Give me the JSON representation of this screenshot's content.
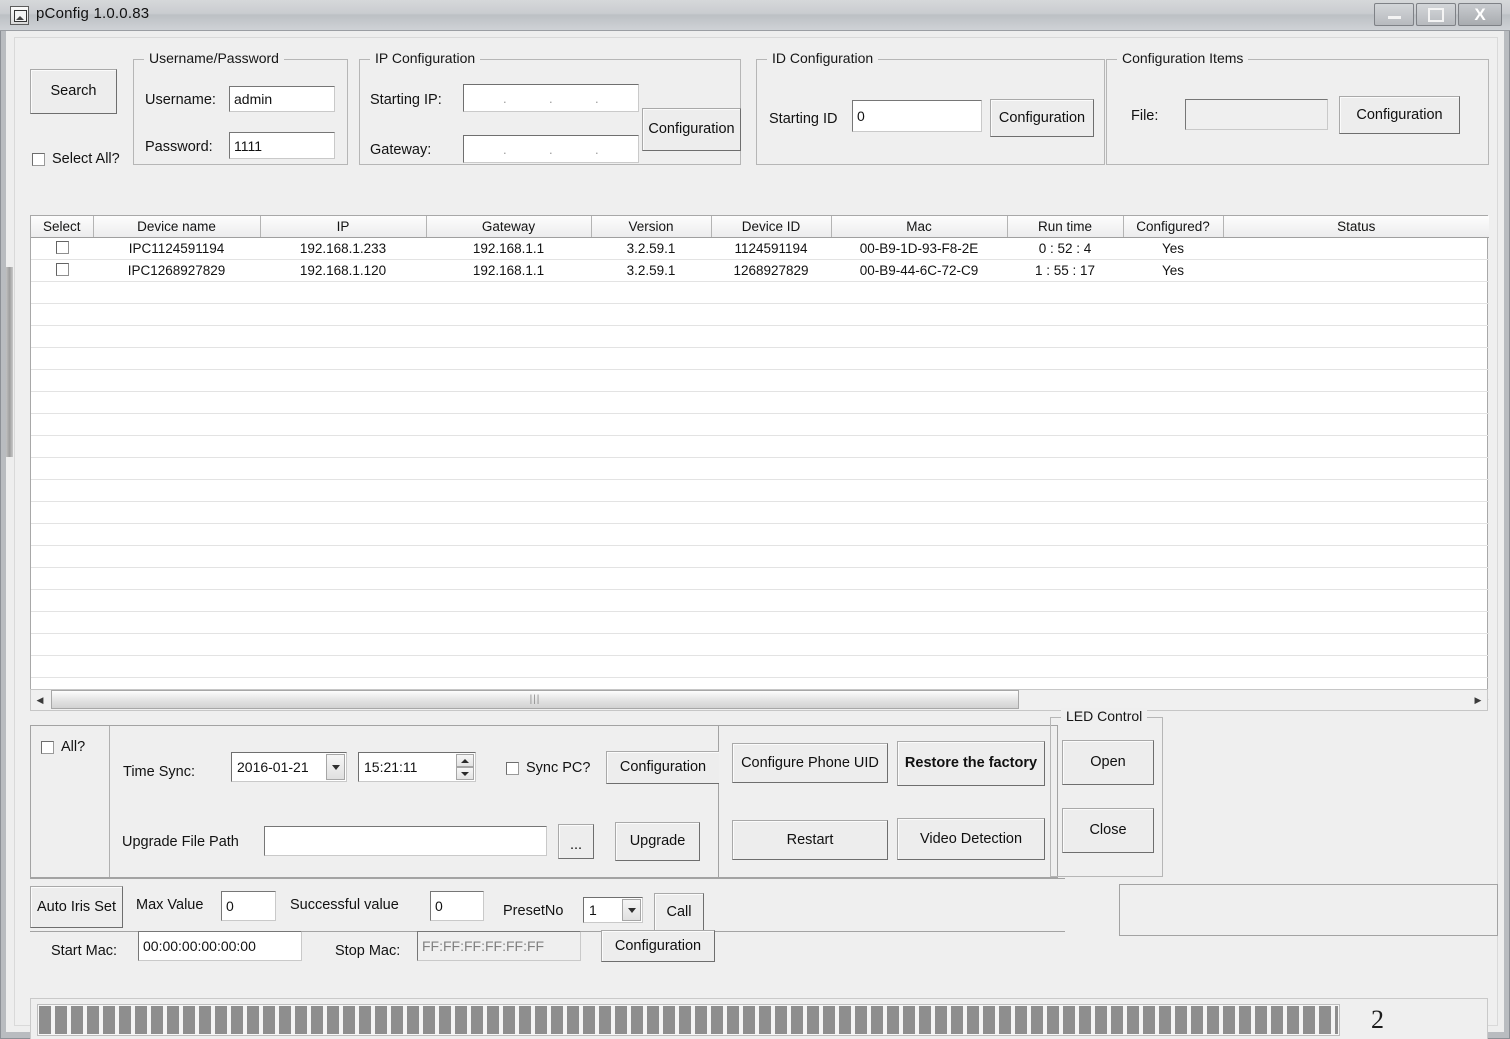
{
  "window": {
    "title": "pConfig  1.0.0.83",
    "icon": "app-icon",
    "minimize_label": "",
    "maximize_label": "",
    "close_label": "X"
  },
  "toolbar": {
    "search_label": "Search",
    "select_all_label": "Select All?"
  },
  "credentials": {
    "group_title": "Username/Password",
    "username_label": "Username:",
    "username_value": "admin",
    "password_label": "Password:",
    "password_value": "1111"
  },
  "ip_config": {
    "group_title": "IP Configuration",
    "starting_ip_label": "Starting IP:",
    "starting_ip_value": "",
    "gateway_label": "Gateway:",
    "gateway_value": "",
    "ip_separator": ".",
    "configuration_label": "Configuration"
  },
  "id_config": {
    "group_title": "ID Configuration",
    "starting_id_label": "Starting ID",
    "starting_id_value": "0",
    "configuration_label": "Configuration"
  },
  "config_items": {
    "group_title": "Configuration Items",
    "file_label": "File:",
    "file_value": "",
    "configuration_label": "Configuration"
  },
  "device_table": {
    "columns": [
      "Select",
      "Device name",
      "IP",
      "Gateway",
      "Version",
      "Device ID",
      "Mac",
      "Run time",
      "Configured?",
      "Status"
    ],
    "rows": [
      {
        "selected": false,
        "device_name": "IPC1124591194",
        "ip": "192.168.1.233",
        "gateway": "192.168.1.1",
        "version": "3.2.59.1",
        "device_id": "1124591194",
        "mac": "00-B9-1D-93-F8-2E",
        "run_time": "0 : 52 : 4",
        "configured": "Yes",
        "status": ""
      },
      {
        "selected": false,
        "device_name": "IPC1268927829",
        "ip": "192.168.1.120",
        "gateway": "192.168.1.1",
        "version": "3.2.59.1",
        "device_id": "1268927829",
        "mac": "00-B9-44-6C-72-C9",
        "run_time": "1 : 55 : 17",
        "configured": "Yes",
        "status": ""
      }
    ],
    "empty_row_count": 19,
    "scroll_left_arrow": "◀",
    "scroll_right_arrow": "▶",
    "scroll_grip": "|||"
  },
  "actions": {
    "all_label": "All?",
    "time_sync_label": "Time Sync:",
    "date_value": "2016-01-21",
    "time_value": "15:21:11",
    "sync_pc_label": "Sync PC?",
    "time_configuration_label": "Configuration",
    "upgrade_path_label": "Upgrade File Path",
    "upgrade_path_value": "",
    "browse_label": "...",
    "upgrade_label": "Upgrade",
    "configure_phone_uid_label": "Configure Phone UID",
    "restore_factory_label": "Restore the factory",
    "restart_label": "Restart",
    "video_detection_label": "Video Detection"
  },
  "led_control": {
    "group_title": "LED Control",
    "open_label": "Open",
    "close_label": "Close"
  },
  "iris": {
    "auto_iris_label": "Auto Iris Set",
    "max_value_label": "Max Value",
    "max_value": "0",
    "successful_value_label": "Successful value",
    "successful_value": "0",
    "preset_no_label": "PresetNo",
    "preset_no_value": "1",
    "call_label": "Call"
  },
  "mac_range": {
    "start_mac_label": "Start Mac:",
    "start_mac_value": "00:00:00:00:00:00",
    "stop_mac_label": "Stop Mac:",
    "stop_mac_value": "FF:FF:FF:FF:FF:FF",
    "configuration_label": "Configuration"
  },
  "progress": {
    "percent": 100,
    "count_label": "2"
  },
  "colors": {
    "window_bg": "#efefef",
    "progress_fill": "#8e8e8e",
    "titlebar": "#c9ccd0"
  }
}
